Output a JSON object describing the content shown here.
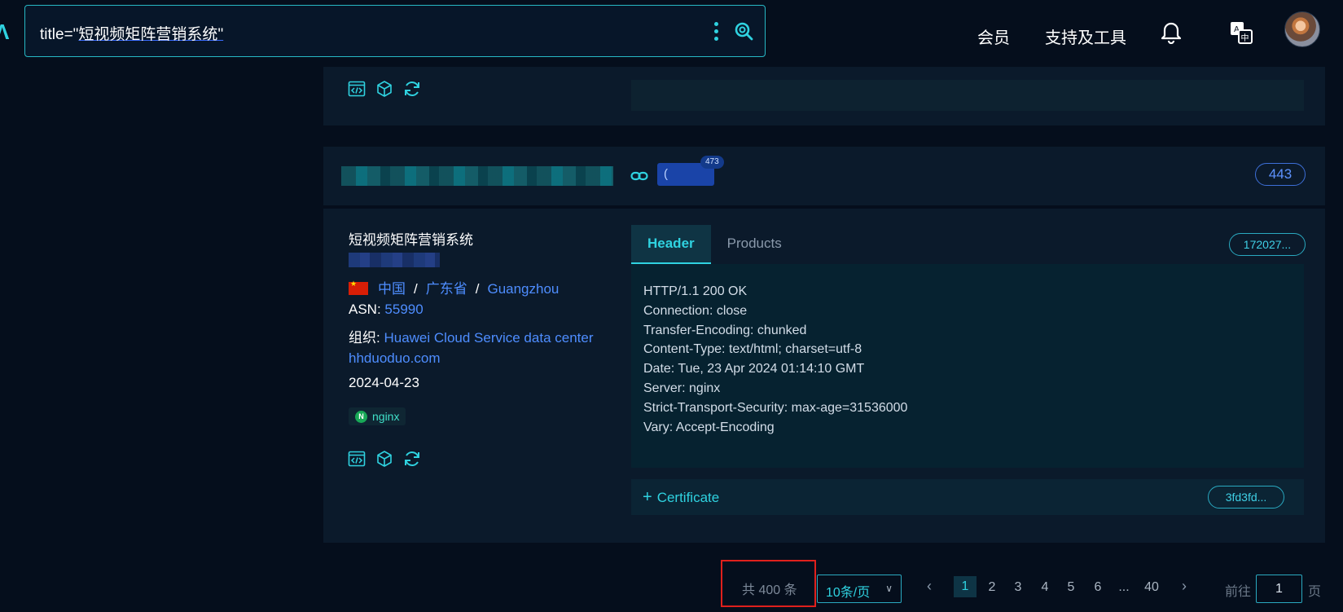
{
  "search": {
    "query_prefix": "title=\"",
    "query_term": "短视频矩阵营销系统",
    "query_suffix": "\""
  },
  "nav": {
    "member": "会员",
    "support": "支持及工具"
  },
  "result": {
    "ip_badge_count": "473",
    "ip_text": "(",
    "port": "443",
    "title": "短视频矩阵营销系统",
    "country": "中国",
    "province": "广东省",
    "city": "Guangzhou",
    "asn_label": "ASN:",
    "asn": "55990",
    "org_label": "组织:",
    "org": "Huawei Cloud Service data center",
    "domain": "hhduoduo.com",
    "date": "2024-04-23",
    "tech": "nginx",
    "tech_letter": "N",
    "tabs": [
      "Header",
      "Products"
    ],
    "header_hash": "172027...",
    "header_text": "HTTP/1.1 200 OK\nConnection: close\nTransfer-Encoding: chunked\nContent-Type: text/html; charset=utf-8\nDate: Tue, 23 Apr 2024 01:14:10 GMT\nServer: nginx\nStrict-Transport-Security: max-age=31536000\nVary: Accept-Encoding",
    "certificate_label": "Certificate",
    "cert_hash": "3fd3fd..."
  },
  "pagination": {
    "total": "共 400 条",
    "page_size": "10条/页",
    "pages": [
      "1",
      "2",
      "3",
      "4",
      "5",
      "6",
      "...",
      "40"
    ],
    "current": "1",
    "goto_label": "前往",
    "goto_value": "1",
    "page_unit": "页"
  },
  "colors": {
    "accent": "#2fd2e0",
    "link": "#4e8dff",
    "highlight_box": "#e0201c"
  }
}
